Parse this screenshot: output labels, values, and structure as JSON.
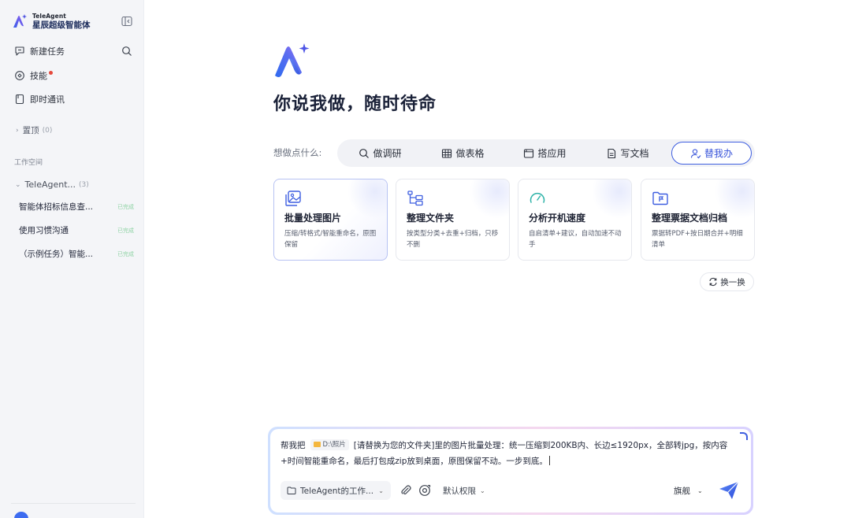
{
  "brand": {
    "name_en": "TeleAgent",
    "name_cn": "星辰超级智能体"
  },
  "sidebar": {
    "new_task": "新建任务",
    "skills": "技能",
    "im": "即时通讯",
    "pinned_label": "置顶",
    "pinned_count": "(0)",
    "workspace_section": "工作空间",
    "workspace_name": "TeleAgent...",
    "workspace_count": "(3)",
    "tasks": [
      {
        "title": "智能体招标信息查...",
        "status": "已完成"
      },
      {
        "title": "使用习惯沟通",
        "status": "已完成"
      },
      {
        "title": "（示例任务）智能...",
        "status": "已完成"
      }
    ]
  },
  "main": {
    "title": "你说我做，随时待命",
    "ask_label": "想做点什么:",
    "tabs": [
      {
        "label": "做调研",
        "icon": "search-icon",
        "active": false
      },
      {
        "label": "做表格",
        "icon": "table-icon",
        "active": false
      },
      {
        "label": "搭应用",
        "icon": "app-window-icon",
        "active": false
      },
      {
        "label": "写文档",
        "icon": "document-icon",
        "active": false
      },
      {
        "label": "替我办",
        "icon": "user-check-icon",
        "active": true
      }
    ],
    "cards": [
      {
        "title": "批量处理图片",
        "desc": "压缩/转格式/智能重命名，原图保留",
        "icon": "image-stack-icon"
      },
      {
        "title": "整理文件夹",
        "desc": "按类型分类+去重+归档，只移不删",
        "icon": "folder-tree-icon"
      },
      {
        "title": "分析开机速度",
        "desc": "自启清单+建议，自动加速不动手",
        "icon": "speed-gauge-icon"
      },
      {
        "title": "整理票据文档归档",
        "desc": "票据转PDF+按日期合并+明细清单",
        "icon": "folder-flag-icon"
      }
    ],
    "refresh": "换一换"
  },
  "composer": {
    "prefix": "帮我把",
    "chip": "D:\\照片",
    "text": "[请替换为您的文件夹]里的图片批量处理：统一压缩到200KB内、长边≤1920px，全部转jpg，按内容+时间智能重命名，最后打包成zip放到桌面，原图保留不动。一步到底。",
    "workspace": "TeleAgent的工作...",
    "permission": "默认权限",
    "model": "旗舰"
  },
  "colors": {
    "accent": "#3f5fe0",
    "done": "#8fd3a5",
    "dot": "#e5483b"
  }
}
